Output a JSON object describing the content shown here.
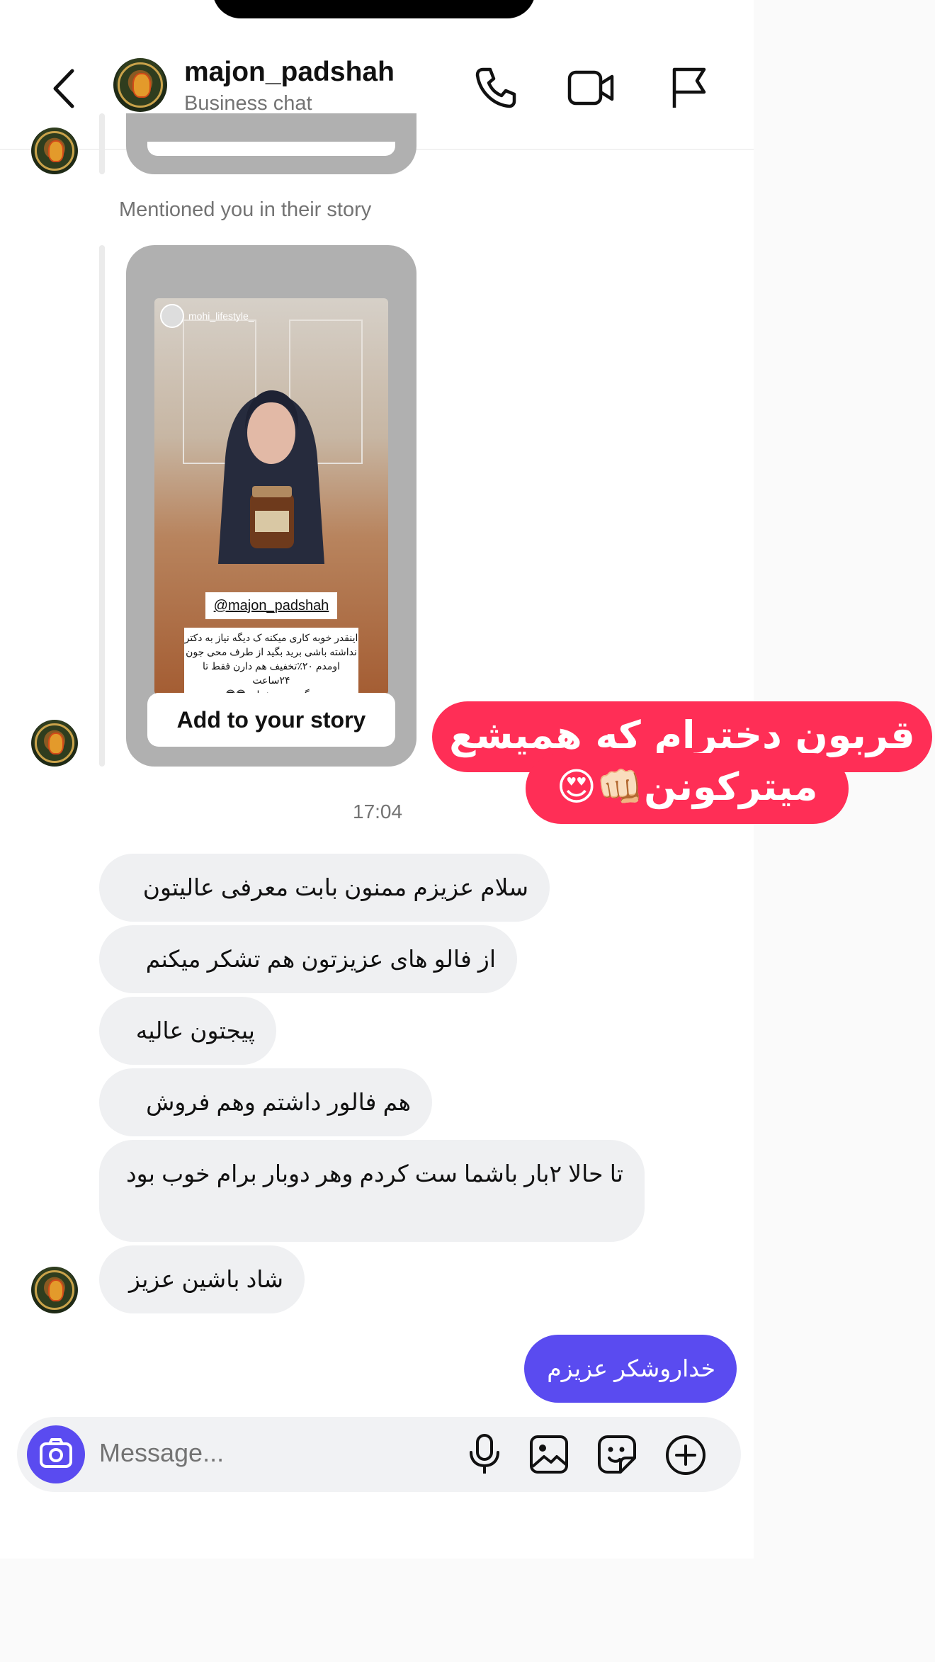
{
  "header": {
    "username": "majon_padshah",
    "subtitle": "Business chat",
    "back_icon": "chevron-left-icon",
    "call_icon": "phone-icon",
    "video_icon": "video-camera-icon",
    "report_icon": "flag-icon"
  },
  "story_section": {
    "mention_label": "Mentioned you in their story",
    "story_account": "mohi_lifestyle_",
    "story_tag": "@majon_padshah",
    "story_caption_lines": [
      "اینقدر خوبه کاری میکنه ک دیگه نیاز به دکتر",
      "نداشته باشی برید بگید از طرف محی جون",
      "اومدم ۲۰٪تخفیف هم دارن فقط تا ۲۴ساعت",
      "دیگه چی میخواید 😎😎"
    ],
    "add_to_story_label": "Add to your story",
    "sticker_line_1": "قربون دخترام که همیشع",
    "sticker_line_2": "میترکونن👊🏻😍"
  },
  "timestamp": "17:04",
  "messages": [
    {
      "side": "left",
      "text": "سلام عزیزم ممنون بابت معرفی عالیتون"
    },
    {
      "side": "left",
      "text": "از فالو های عزیزتون هم تشکر میکنم"
    },
    {
      "side": "left",
      "text": "پیجتون عالیه"
    },
    {
      "side": "left",
      "text": "هم فالور داشتم وهم فروش"
    },
    {
      "side": "left",
      "text": "تا حالا ۲بار باشما ست کردم وهر دوبار برام خوب بود"
    },
    {
      "side": "left",
      "text": "شاد باشین عزیز"
    },
    {
      "side": "right",
      "text": "خداروشکر عزیزم"
    }
  ],
  "composer": {
    "placeholder": "Message...",
    "camera_icon": "camera-icon",
    "mic_icon": "microphone-icon",
    "gallery_icon": "image-icon",
    "sticker_icon": "sticker-icon",
    "add_icon": "plus-circle-icon"
  },
  "colors": {
    "accent": "#5a4bf0",
    "bubble_received": "#eff0f2",
    "sticker": "#ff2e56",
    "secondary_text": "#737373"
  }
}
